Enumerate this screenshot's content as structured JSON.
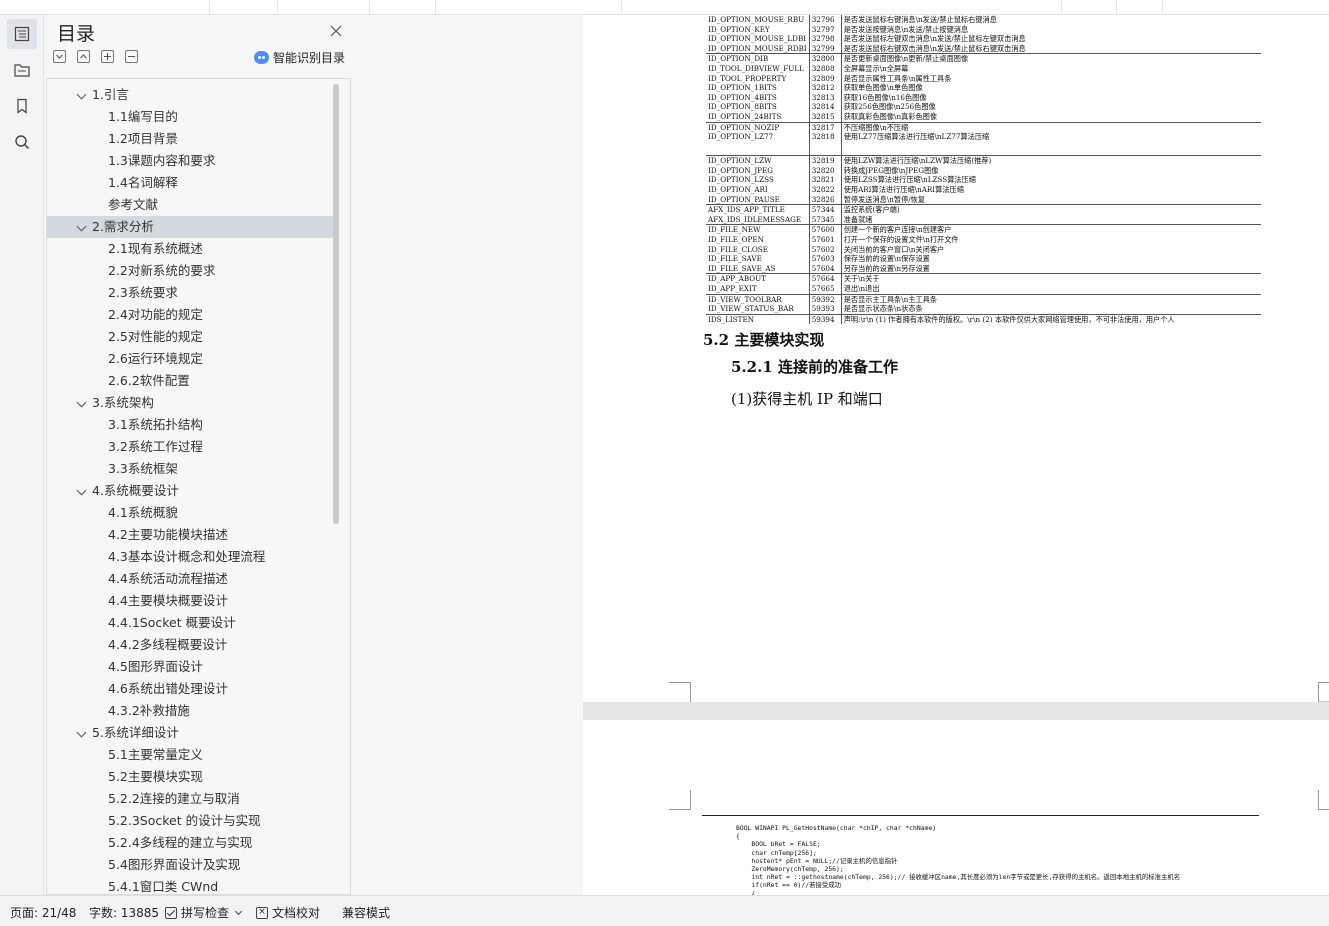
{
  "toc": {
    "title": "目录",
    "ai_button_label": "智能识别目录",
    "items": [
      {
        "label": "1.引言",
        "level": 1,
        "expanded": true
      },
      {
        "label": "1.1编写目的",
        "level": 2
      },
      {
        "label": "1.2项目背景",
        "level": 2
      },
      {
        "label": "1.3课题内容和要求",
        "level": 2
      },
      {
        "label": "1.4名词解释",
        "level": 2
      },
      {
        "label": "参考文献",
        "level": 2
      },
      {
        "label": "2.需求分析",
        "level": 1,
        "expanded": true,
        "selected": true
      },
      {
        "label": "2.1现有系统概述",
        "level": 2
      },
      {
        "label": "2.2对新系统的要求",
        "level": 2
      },
      {
        "label": "2.3系统要求",
        "level": 2
      },
      {
        "label": "2.4对功能的规定",
        "level": 2
      },
      {
        "label": "2.5对性能的规定",
        "level": 2
      },
      {
        "label": "2.6运行环境规定",
        "level": 2
      },
      {
        "label": "2.6.2软件配置",
        "level": 2
      },
      {
        "label": "3.系统架构",
        "level": 1,
        "expanded": true
      },
      {
        "label": "3.1系统拓扑结构",
        "level": 2
      },
      {
        "label": "3.2系统工作过程",
        "level": 2
      },
      {
        "label": "3.3系统框架",
        "level": 2
      },
      {
        "label": "4.系统概要设计",
        "level": 1,
        "expanded": true
      },
      {
        "label": "4.1系统概貌",
        "level": 2
      },
      {
        "label": "4.2主要功能模块描述",
        "level": 2
      },
      {
        "label": "4.3基本设计概念和处理流程",
        "level": 2
      },
      {
        "label": "4.4系统活动流程描述",
        "level": 2
      },
      {
        "label": "4.4主要模块概要设计",
        "level": 2
      },
      {
        "label": "4.4.1Socket 概要设计",
        "level": 2
      },
      {
        "label": "4.4.2多线程概要设计",
        "level": 2
      },
      {
        "label": "4.5图形界面设计",
        "level": 2
      },
      {
        "label": "4.6系统出错处理设计",
        "level": 2
      },
      {
        "label": "4.3.2补救措施",
        "level": 2
      },
      {
        "label": "5.系统详细设计",
        "level": 1,
        "expanded": true
      },
      {
        "label": "5.1主要常量定义",
        "level": 2
      },
      {
        "label": "5.2主要模块实现",
        "level": 2
      },
      {
        "label": "5.2.2连接的建立与取消",
        "level": 2
      },
      {
        "label": "5.2.3Socket 的设计与实现",
        "level": 2
      },
      {
        "label": "5.2.4多线程的建立与实现",
        "level": 2
      },
      {
        "label": "5.4图形界面设计及实现",
        "level": 2
      },
      {
        "label": "5.4.1窗口类 CWnd",
        "level": 2
      }
    ]
  },
  "document": {
    "id_table": [
      [
        "ID_OPTION_MOUSE_RBU",
        "32796",
        "是否发送鼠标右键消息\\n发送/禁止鼠标右键消息",
        ""
      ],
      [
        "ID_OPTION_KEY",
        "32797",
        "是否发送按键消息\\n发送/禁止按键消息",
        ""
      ],
      [
        "ID_OPTION_MOUSE_LDBI",
        "32798",
        "是否发送鼠标左键双击消息\\n发送/禁止鼠标左键双击消息",
        ""
      ],
      [
        "ID_OPTION_MOUSE_RDBI",
        "32799",
        "是否发送鼠标右键双击消息\\n发送/禁止鼠标右键双击消息",
        ""
      ],
      [
        "ID_OPTION_DIB",
        "32800",
        "是否更新桌面图像\\n更新/禁止桌面图像",
        "top"
      ],
      [
        "ID_TOOL_DIBVIEW_FULL",
        "32808",
        "全屏幕显示\\n全屏幕",
        ""
      ],
      [
        "ID_TOOL_PROPERTY",
        "32809",
        "是否显示属性工具条\\n属性工具条",
        ""
      ],
      [
        "ID_OPTION_1BITS",
        "32812",
        "获取单色图像\\n单色图像",
        ""
      ],
      [
        "ID_OPTION_4BITS",
        "32813",
        "获取16色图像\\n16色图像",
        ""
      ],
      [
        "ID_OPTION_8BITS",
        "32814",
        "获取256色图像\\n256色图像",
        ""
      ],
      [
        "ID_OPTION_24BITS",
        "32815",
        "获取真彩色图像\\n真彩色图像",
        ""
      ],
      [
        "ID_OPTION_NOZIP",
        "32817",
        "不压缩图像\\n不压缩",
        "top"
      ],
      [
        "ID_OPTION_LZ77",
        "32818",
        "使用LZ77压缩算法进行压缩\\nLZ77算法压缩",
        ""
      ],
      [
        "",
        "",
        "",
        "gap"
      ],
      [
        "ID_OPTION_LZW",
        "32819",
        "使用LZW算法进行压缩\\nLZW算法压缩(推荐)",
        "top"
      ],
      [
        "ID_OPTION_JPEG",
        "32820",
        "转换成JPEG图像\\nJPEG图像",
        ""
      ],
      [
        "ID_OPTION_LZSS",
        "32821",
        "使用LZSS算法进行压缩\\nLZSS算法压缩",
        ""
      ],
      [
        "ID_OPTION_ARI",
        "32822",
        "使用ARI算法进行压缩\\nARI算法压缩",
        ""
      ],
      [
        "ID_OPTION_PAUSE",
        "32826",
        "暂停发送消息\\n暂停/恢复",
        ""
      ],
      [
        "AFX_IDS_APP_TITLE",
        "57344",
        "监控系统(客户端)",
        "top"
      ],
      [
        "AFX_IDS_IDLEMESSAGE",
        "57345",
        "准备就绪",
        ""
      ],
      [
        "ID_FILE_NEW",
        "57600",
        "创建一个新的客户连接\\n创建客户",
        "top"
      ],
      [
        "ID_FILE_OPEN",
        "57601",
        "打开一个保存的设置文件\\n打开文件",
        ""
      ],
      [
        "ID_FILE_CLOSE",
        "57602",
        "关闭当前的客户窗口\\n关闭客户",
        ""
      ],
      [
        "ID_FILE_SAVE",
        "57603",
        "保存当前的设置\\n保存设置",
        ""
      ],
      [
        "ID_FILE_SAVE_AS",
        "57604",
        "另存当前的设置\\n另存设置",
        ""
      ],
      [
        "ID_APP_ABOUT",
        "57664",
        "关于\\n关于",
        "top"
      ],
      [
        "ID_APP_EXIT",
        "57665",
        "退出\\n退出",
        ""
      ],
      [
        "ID_VIEW_TOOLBAR",
        "59392",
        "是否显示主工具条\\n主工具条",
        "top"
      ],
      [
        "ID_VIEW_STATUS_BAR",
        "59393",
        "是否显示状态条\\n状态条",
        ""
      ],
      [
        "IDS_LISTEN",
        "59394",
        "声明:\\r\\n      (1) 作者拥有本软件的版权。\\r\\n      (2) 本软件仅供大家网络管理使用，不可非法使用，用户个人",
        "top"
      ]
    ],
    "section_heading": "5.2 主要模块实现",
    "subsection_heading": "5.2.1 连接前的准备工作",
    "paragraph": "(1)获得主机 IP 和端口",
    "code_lines": [
      "BOOL WINAPI PL_GetHostName(char *chIP, char *chName)",
      "{",
      "    BOOL bRet = FALSE;",
      "    char chTemp[256];",
      "    hostent* pEnt = NULL;//记录主机的信息指针",
      "    ZeroMemory(chTemp, 256);",
      "    int nRet = ::gethostname(chTemp, 256);// 接收缓冲区name,其长度必须为len字节或是更长,存获得的主机名。返回本地主机的标准主机名",
      "    if(nRet == 0)//若接受成功",
      "    {"
    ]
  },
  "status": {
    "page": "页面: 21/48",
    "words": "字数: 13885",
    "spell_check": "拼写检查",
    "proofread": "文档校对",
    "compat_mode": "兼容模式"
  }
}
